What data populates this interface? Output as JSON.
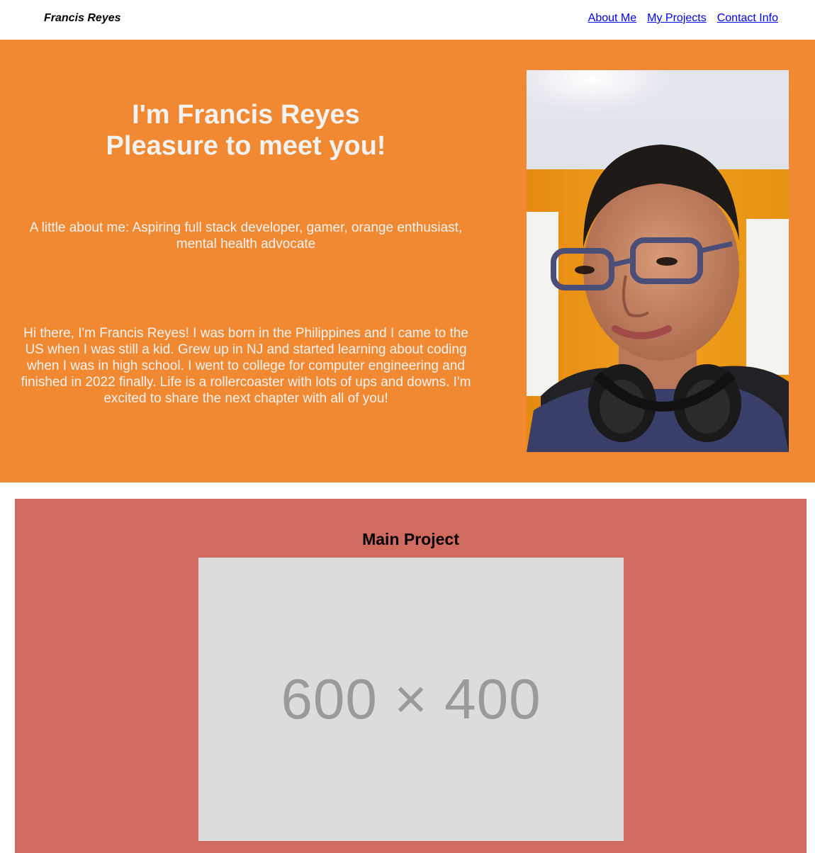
{
  "nav": {
    "brand": "Francis Reyes",
    "links": [
      "About Me",
      "My Projects",
      "Contact Info"
    ]
  },
  "hero": {
    "title_line1": "I'm Francis Reyes",
    "title_line2": "Pleasure to meet you!",
    "tagline": "A little about me: Aspiring full stack developer, gamer, orange enthusiast, mental health advocate",
    "bio": "Hi there, I'm Francis Reyes! I was born in the Philippines and I came to the US when I was still a kid. Grew up in NJ and started learning about coding when I was in high school. I went to college for computer engineering and finished in 2022 finally. Life is a rollercoaster with lots of ups and downs. I'm excited to share the next chapter with all of you!"
  },
  "main_project": {
    "title": "Main Project",
    "placeholder_label": "600 × 400"
  },
  "colors": {
    "hero_bg": "#f08932",
    "section_bg": "#d16b60",
    "placeholder_bg": "#dcdcdc",
    "link": "#0000ee"
  }
}
